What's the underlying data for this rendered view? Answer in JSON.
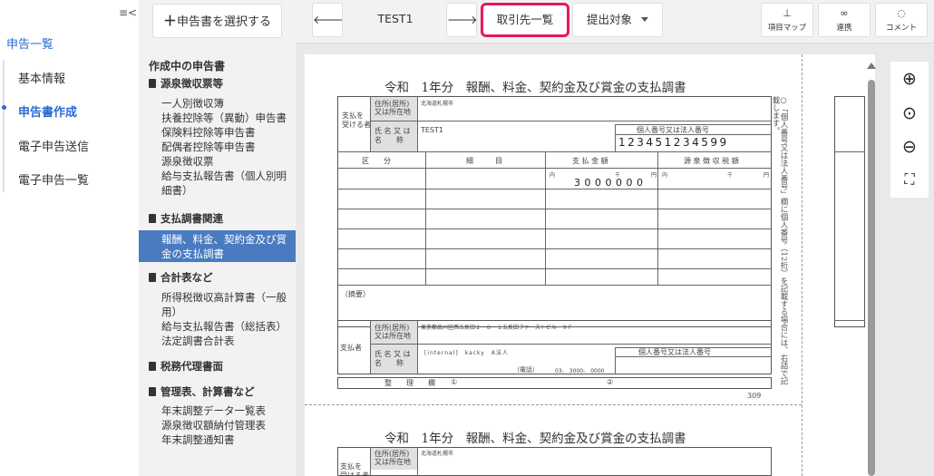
{
  "sidebar": {
    "items": [
      "申告一覧",
      "基本情報",
      "申告書作成",
      "電子申告送信",
      "電子申告一覧"
    ]
  },
  "panel": {
    "select_label": "申告書を選択する",
    "title": "作成中の申告書",
    "groups": [
      {
        "label": "源泉徴収票等",
        "items": [
          "一人別徴収簿",
          "扶養控除等（異動）申告書",
          "保険料控除等申告書",
          "配偶者控除等申告書",
          "源泉徴収票",
          "給与支払報告書（個人別明細書）"
        ]
      },
      {
        "label": "支払調書関連",
        "items": [
          "報酬、料金、契約金及び賞金の支払調書"
        ]
      },
      {
        "label": "合計表など",
        "items": [
          "所得税徴収高計算書（一般用）",
          "給与支払報告書（総括表）",
          "法定調書合計表"
        ]
      },
      {
        "label": "税務代理書面",
        "items": []
      },
      {
        "label": "管理表、計算書など",
        "items": [
          "年末調整データ一覧表",
          "源泉徴収額納付管理表",
          "年末調整通知書"
        ]
      }
    ]
  },
  "toolbar": {
    "title": "TEST1",
    "list_label": "取引先一覧",
    "submit_label": "提出対象",
    "map_label": "項目マップ",
    "link_label": "連携",
    "comment_label": "コメント"
  },
  "form": {
    "title": "令和　1年分　報酬、料金、契約金及び賞金の支払調書",
    "payee_label": "支払を\n受ける者",
    "address_label": "住所(居所)\n又は所在地",
    "address_value": "北海道札幌市",
    "name_label": "氏 名 又 は\n名　　称",
    "name_value": "TEST1",
    "mynumber_label": "個人番号又は法人番号",
    "mynumber_value": "123451234599",
    "col_kubun": "区　　分",
    "col_saimoku": "細　　　目",
    "col_amount": "支 払 金 額",
    "col_tax": "源 泉 徴 収 税 額",
    "unit_uchi": "内",
    "unit_sen": "千",
    "unit_en": "円",
    "amount_value": "3000000",
    "tekiyo_label": "（摘要）",
    "payer_label": "支払者",
    "payer_address_value": "東京都品川区西五反田２－８－１五反田ファーストビル　９Ｆ",
    "payer_name_value": "[internal]　kacky　A法人",
    "phone_label": "（電話）",
    "phone_value": "03-　3000-　0000",
    "payer_number_label": "個人番号又は法人番号",
    "seiri_label": "整　　理　　欄",
    "seiri_1": "①",
    "seiri_2": "②",
    "code": "309",
    "side_text": "○「個人番号又は法人番号」欄に個人番号（12桁）を記載する場合には、右詰で記載します。",
    "form2_title": "令和　1年分　報酬、料金、契約金及び賞金の支払調書"
  },
  "colors": {
    "accent": "#2a6bd4",
    "highlight": "#e6195e",
    "selected": "#4a7bc0"
  }
}
